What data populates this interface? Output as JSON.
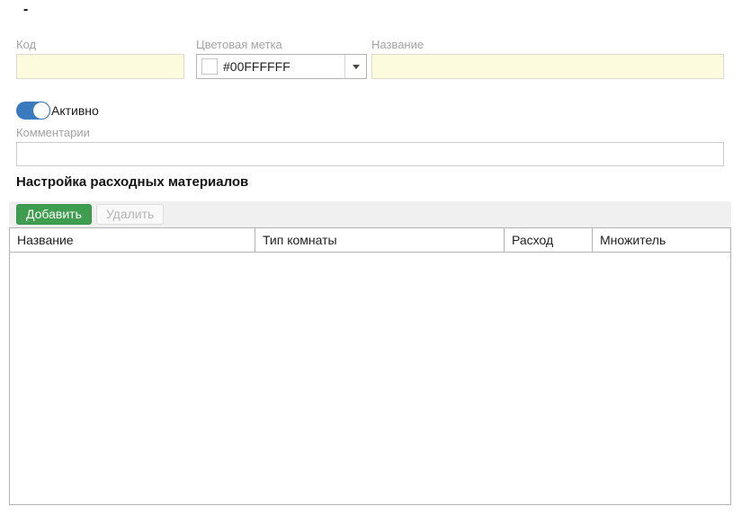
{
  "page": {
    "collapse_dash": "-"
  },
  "form": {
    "code": {
      "label": "Код",
      "value": "",
      "placeholder": ""
    },
    "color_tag": {
      "label": "Цветовая метка",
      "value": "#00FFFFFF",
      "swatch_color": "#FFFFFF"
    },
    "name": {
      "label": "Название",
      "value": "",
      "placeholder": ""
    },
    "active": {
      "label": "Активно",
      "state": "on"
    },
    "comments": {
      "label": "Комментарии",
      "value": "",
      "placeholder": ""
    }
  },
  "section": {
    "title": "Настройка расходных материалов",
    "toolbar": {
      "add_label": "Добавить",
      "delete_label": "Удалить"
    },
    "table": {
      "columns": [
        "Название",
        "Тип комнаты",
        "Расход",
        "Множитель"
      ],
      "rows": []
    }
  },
  "colors": {
    "accent_green": "#3f9d4f",
    "toggle_blue": "#3a7abf",
    "input_yellow": "#fdfbdd",
    "label_gray": "#a3a3a3",
    "table_border": "#b3b3b3",
    "toolbar_bg": "#f0f0f0"
  }
}
